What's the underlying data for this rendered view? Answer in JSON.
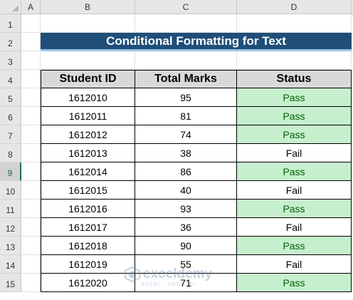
{
  "columns": [
    "A",
    "B",
    "C",
    "D"
  ],
  "rows": [
    "1",
    "2",
    "3",
    "4",
    "5",
    "6",
    "7",
    "8",
    "9",
    "10",
    "11",
    "12",
    "13",
    "14",
    "15"
  ],
  "selected_row": "9",
  "title": "Conditional Formatting for Text",
  "headers": [
    "Student ID",
    "Total Marks",
    "Status"
  ],
  "records": [
    {
      "id": "1612010",
      "marks": "95",
      "status": "Pass"
    },
    {
      "id": "1612011",
      "marks": "81",
      "status": "Pass"
    },
    {
      "id": "1612012",
      "marks": "74",
      "status": "Pass"
    },
    {
      "id": "1612013",
      "marks": "38",
      "status": "Fail"
    },
    {
      "id": "1612014",
      "marks": "86",
      "status": "Pass"
    },
    {
      "id": "1612015",
      "marks": "40",
      "status": "Fail"
    },
    {
      "id": "1612016",
      "marks": "93",
      "status": "Pass"
    },
    {
      "id": "1612017",
      "marks": "36",
      "status": "Fail"
    },
    {
      "id": "1612018",
      "marks": "90",
      "status": "Pass"
    },
    {
      "id": "1612019",
      "marks": "55",
      "status": "Fail"
    },
    {
      "id": "1612020",
      "marks": "71",
      "status": "Pass"
    }
  ],
  "watermark": {
    "name": "exceldemy",
    "tagline": "EXCEL · DATA · BI"
  },
  "colors": {
    "title_bg": "#1f4e79",
    "pass_bg": "#c6efce",
    "pass_text": "#006100",
    "header_bg": "#d9d9d9"
  }
}
